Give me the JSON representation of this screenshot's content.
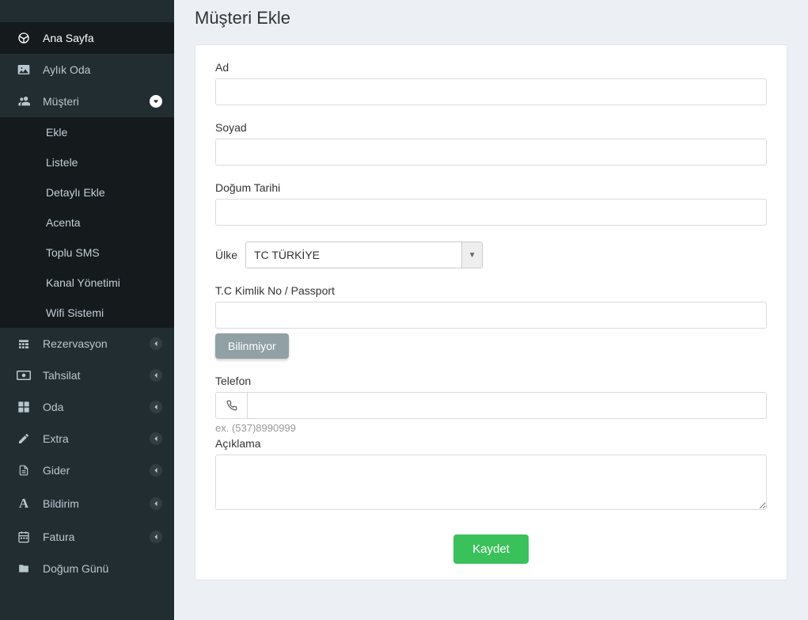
{
  "page": {
    "title": "Müşteri Ekle"
  },
  "sidebar": {
    "items": [
      {
        "label": "Ana Sayfa",
        "icon": "dashboard",
        "active": true,
        "expand": null
      },
      {
        "label": "Aylık Oda",
        "icon": "image",
        "expand": null
      },
      {
        "label": "Müşteri",
        "icon": "users",
        "expand": "down",
        "sub": [
          {
            "label": "Ekle"
          },
          {
            "label": "Listele"
          },
          {
            "label": "Detaylı Ekle"
          },
          {
            "label": "Acenta"
          },
          {
            "label": "Toplu SMS"
          },
          {
            "label": "Kanal Yönetimi"
          },
          {
            "label": "Wifi Sistemi"
          }
        ]
      },
      {
        "label": "Rezervasyon",
        "icon": "calendar-grid",
        "expand": "left"
      },
      {
        "label": "Tahsilat",
        "icon": "money",
        "expand": "left"
      },
      {
        "label": "Oda",
        "icon": "grid4",
        "expand": "left"
      },
      {
        "label": "Extra",
        "icon": "edit",
        "expand": "left"
      },
      {
        "label": "Gider",
        "icon": "doc",
        "expand": "left"
      },
      {
        "label": "Bildirim",
        "icon": "letter-a",
        "expand": "left"
      },
      {
        "label": "Fatura",
        "icon": "calendar",
        "expand": "left"
      },
      {
        "label": "Doğum Günü",
        "icon": "folder",
        "expand": null
      }
    ]
  },
  "form": {
    "ad_label": "Ad",
    "ad_value": "",
    "soyad_label": "Soyad",
    "soyad_value": "",
    "dogum_label": "Doğum Tarihi",
    "dogum_value": "",
    "ulke_label": "Ülke",
    "ulke_value": "TC TÜRKİYE",
    "tc_label": "T.C Kimlik No / Passport",
    "tc_value": "",
    "bilinmiyor_label": "Bilinmiyor",
    "telefon_label": "Telefon",
    "telefon_value": "",
    "telefon_hint": "ex. (537)8990999",
    "aciklama_label": "Açıklama",
    "aciklama_value": "",
    "save_label": "Kaydet"
  }
}
